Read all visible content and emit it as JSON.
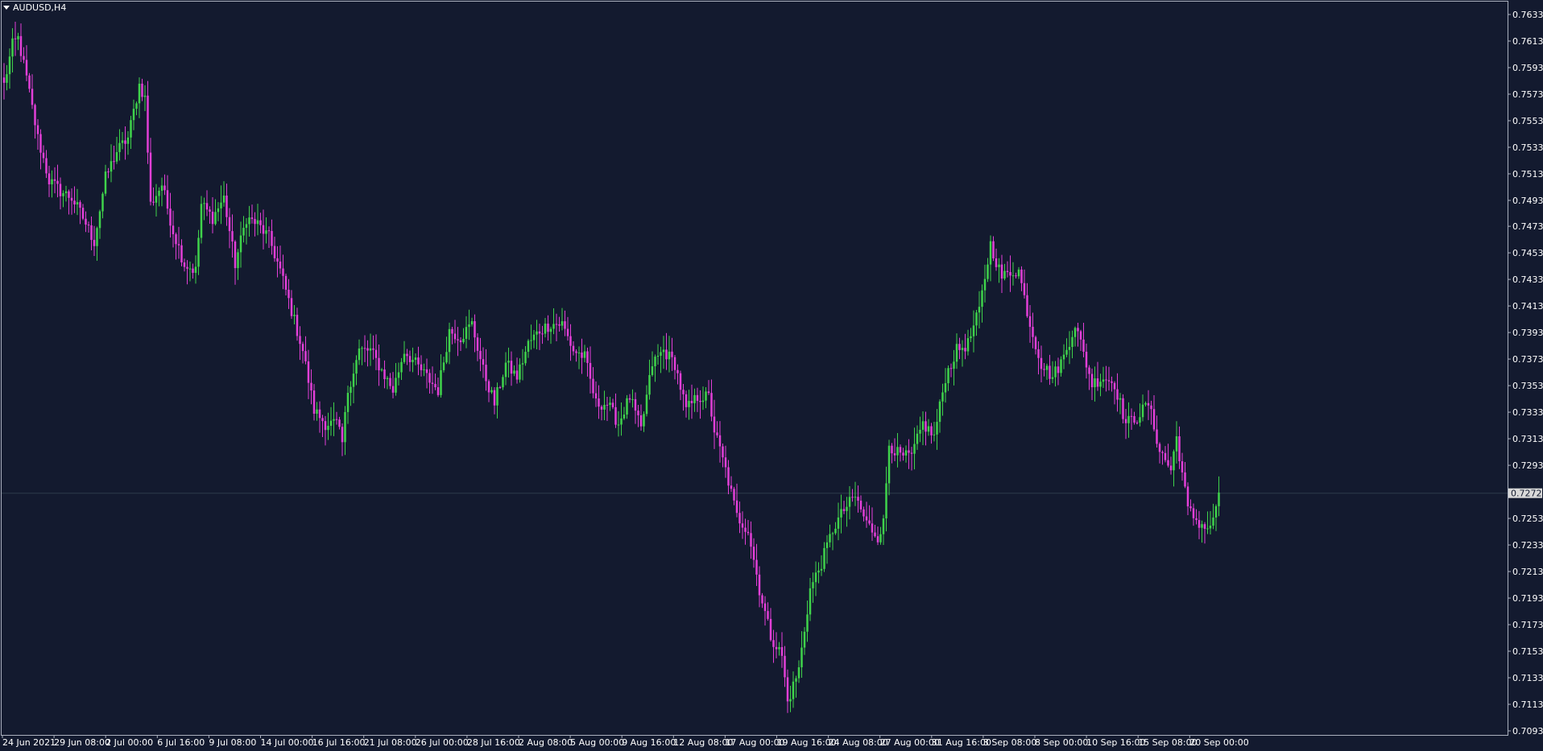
{
  "header": {
    "symbol_timeframe": "AUDUSD,H4"
  },
  "colors": {
    "background": "#131a2f",
    "frame": "#aab0be",
    "bull": "#3fd34b",
    "bear": "#e23fd7",
    "text": "#ffffff",
    "current_price_line": "#2c3a4a",
    "current_price_box": "#d9d9d9"
  },
  "chart_data": {
    "type": "candlestick",
    "symbol": "AUDUSD",
    "timeframe": "H4",
    "price_axis": {
      "ylim": [
        0.70935,
        0.7633
      ],
      "ticks": [
        "0.76330",
        "0.76130",
        "0.75930",
        "0.75730",
        "0.75530",
        "0.75330",
        "0.75130",
        "0.74930",
        "0.74735",
        "0.74535",
        "0.74335",
        "0.74135",
        "0.73935",
        "0.73735",
        "0.73535",
        "0.73335",
        "0.73135",
        "0.72935",
        "0.72535",
        "0.72335",
        "0.72135",
        "0.71935",
        "0.71735",
        "0.71535",
        "0.71335",
        "0.71135",
        "0.70935"
      ]
    },
    "time_axis": {
      "labels": [
        "24 Jun 2021",
        "29 Jun 08:00",
        "2 Jul 00:00",
        "6 Jul 16:00",
        "9 Jul 08:00",
        "14 Jul 00:00",
        "16 Jul 16:00",
        "21 Jul 08:00",
        "26 Jul 00:00",
        "28 Jul 16:00",
        "2 Aug 08:00",
        "5 Aug 00:00",
        "9 Aug 16:00",
        "12 Aug 08:00",
        "17 Aug 00:00",
        "19 Aug 16:00",
        "24 Aug 08:00",
        "27 Aug 00:00",
        "31 Aug 16:00",
        "3 Sep 08:00",
        "8 Sep 00:00",
        "10 Sep 16:00",
        "15 Sep 08:00",
        "20 Sep 00:00"
      ]
    },
    "current_price": "0.72725",
    "close_path": [
      [
        0,
        0.758
      ],
      [
        3,
        0.761
      ],
      [
        5,
        0.7615
      ],
      [
        8,
        0.7585
      ],
      [
        12,
        0.754
      ],
      [
        16,
        0.7508
      ],
      [
        20,
        0.75
      ],
      [
        24,
        0.7495
      ],
      [
        28,
        0.748
      ],
      [
        32,
        0.7462
      ],
      [
        36,
        0.751
      ],
      [
        40,
        0.753
      ],
      [
        44,
        0.754
      ],
      [
        48,
        0.758
      ],
      [
        50,
        0.757
      ],
      [
        52,
        0.749
      ],
      [
        56,
        0.7505
      ],
      [
        60,
        0.747
      ],
      [
        64,
        0.7445
      ],
      [
        68,
        0.744
      ],
      [
        70,
        0.749
      ],
      [
        74,
        0.748
      ],
      [
        78,
        0.7495
      ],
      [
        82,
        0.7445
      ],
      [
        86,
        0.748
      ],
      [
        90,
        0.7475
      ],
      [
        94,
        0.7465
      ],
      [
        98,
        0.744
      ],
      [
        102,
        0.741
      ],
      [
        106,
        0.738
      ],
      [
        110,
        0.7335
      ],
      [
        114,
        0.7325
      ],
      [
        118,
        0.7325
      ],
      [
        120,
        0.731
      ],
      [
        122,
        0.735
      ],
      [
        126,
        0.738
      ],
      [
        130,
        0.738
      ],
      [
        134,
        0.7365
      ],
      [
        138,
        0.735
      ],
      [
        142,
        0.738
      ],
      [
        146,
        0.737
      ],
      [
        150,
        0.736
      ],
      [
        154,
        0.735
      ],
      [
        158,
        0.7395
      ],
      [
        162,
        0.739
      ],
      [
        166,
        0.74
      ],
      [
        170,
        0.7365
      ],
      [
        174,
        0.734
      ],
      [
        178,
        0.737
      ],
      [
        182,
        0.736
      ],
      [
        186,
        0.7385
      ],
      [
        190,
        0.7395
      ],
      [
        194,
        0.74
      ],
      [
        198,
        0.74
      ],
      [
        202,
        0.738
      ],
      [
        206,
        0.7375
      ],
      [
        210,
        0.734
      ],
      [
        214,
        0.734
      ],
      [
        218,
        0.7325
      ],
      [
        222,
        0.7345
      ],
      [
        226,
        0.732
      ],
      [
        230,
        0.737
      ],
      [
        234,
        0.738
      ],
      [
        238,
        0.737
      ],
      [
        242,
        0.7335
      ],
      [
        246,
        0.7345
      ],
      [
        250,
        0.7345
      ],
      [
        252,
        0.732
      ],
      [
        256,
        0.729
      ],
      [
        260,
        0.7255
      ],
      [
        264,
        0.7245
      ],
      [
        268,
        0.72
      ],
      [
        272,
        0.7165
      ],
      [
        276,
        0.715
      ],
      [
        278,
        0.7115
      ],
      [
        282,
        0.714
      ],
      [
        286,
        0.72
      ],
      [
        290,
        0.722
      ],
      [
        294,
        0.7245
      ],
      [
        298,
        0.726
      ],
      [
        302,
        0.727
      ],
      [
        306,
        0.725
      ],
      [
        310,
        0.724
      ],
      [
        312,
        0.725
      ],
      [
        314,
        0.731
      ],
      [
        318,
        0.73
      ],
      [
        322,
        0.73
      ],
      [
        326,
        0.7325
      ],
      [
        330,
        0.7315
      ],
      [
        334,
        0.736
      ],
      [
        338,
        0.738
      ],
      [
        342,
        0.7385
      ],
      [
        346,
        0.741
      ],
      [
        350,
        0.746
      ],
      [
        354,
        0.7435
      ],
      [
        358,
        0.744
      ],
      [
        360,
        0.744
      ],
      [
        364,
        0.74
      ],
      [
        368,
        0.737
      ],
      [
        372,
        0.736
      ],
      [
        376,
        0.7375
      ],
      [
        380,
        0.74
      ],
      [
        382,
        0.7385
      ],
      [
        386,
        0.7355
      ],
      [
        390,
        0.736
      ],
      [
        394,
        0.7355
      ],
      [
        398,
        0.7325
      ],
      [
        402,
        0.733
      ],
      [
        406,
        0.734
      ],
      [
        410,
        0.7305
      ],
      [
        414,
        0.729
      ],
      [
        416,
        0.7315
      ],
      [
        420,
        0.726
      ],
      [
        424,
        0.725
      ],
      [
        428,
        0.7245
      ],
      [
        431,
        0.7273
      ]
    ]
  }
}
